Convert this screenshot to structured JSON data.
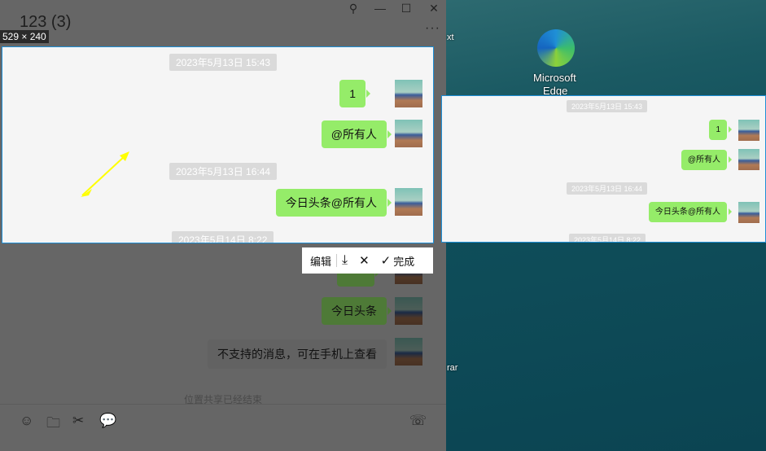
{
  "window": {
    "title": "123 (3)",
    "more": "···"
  },
  "controls": {
    "pin": "⚲",
    "minimize": "—",
    "maximize": "☐",
    "close": "✕"
  },
  "selection": {
    "size_label": "529 × 240"
  },
  "messages": [
    {
      "type": "time",
      "text": "2023年5月13日 15:43"
    },
    {
      "type": "msg",
      "text": "1"
    },
    {
      "type": "msg",
      "text": "@所有人"
    },
    {
      "type": "time",
      "text": "2023年5月13日 16:44"
    },
    {
      "type": "msg",
      "text": "今日头条@所有人"
    },
    {
      "type": "time",
      "text": "2023年5月14日 8:22"
    },
    {
      "type": "msg",
      "text": "今日头条"
    },
    {
      "type": "msg",
      "text": "不支持的消息，可在手机上查看"
    },
    {
      "type": "system",
      "text": "位置共享已经结束"
    }
  ],
  "toolbar": {
    "edit": "编辑",
    "download": "⤓",
    "cancel": "✕",
    "done": "完成",
    "done_icon": "✓"
  },
  "desktop": {
    "edge_label1": "Microsoft",
    "edge_label2": "Edge",
    "txt": "xt",
    "rar": "rar"
  },
  "input_bar": {
    "emoji": "☺",
    "folder": "🗀",
    "scissors": "✂",
    "chat": "💬",
    "call": "☏"
  },
  "colors": {
    "bubble": "#95ec69",
    "selection_border": "#1e8fd6",
    "arrow": "#ffff00"
  }
}
